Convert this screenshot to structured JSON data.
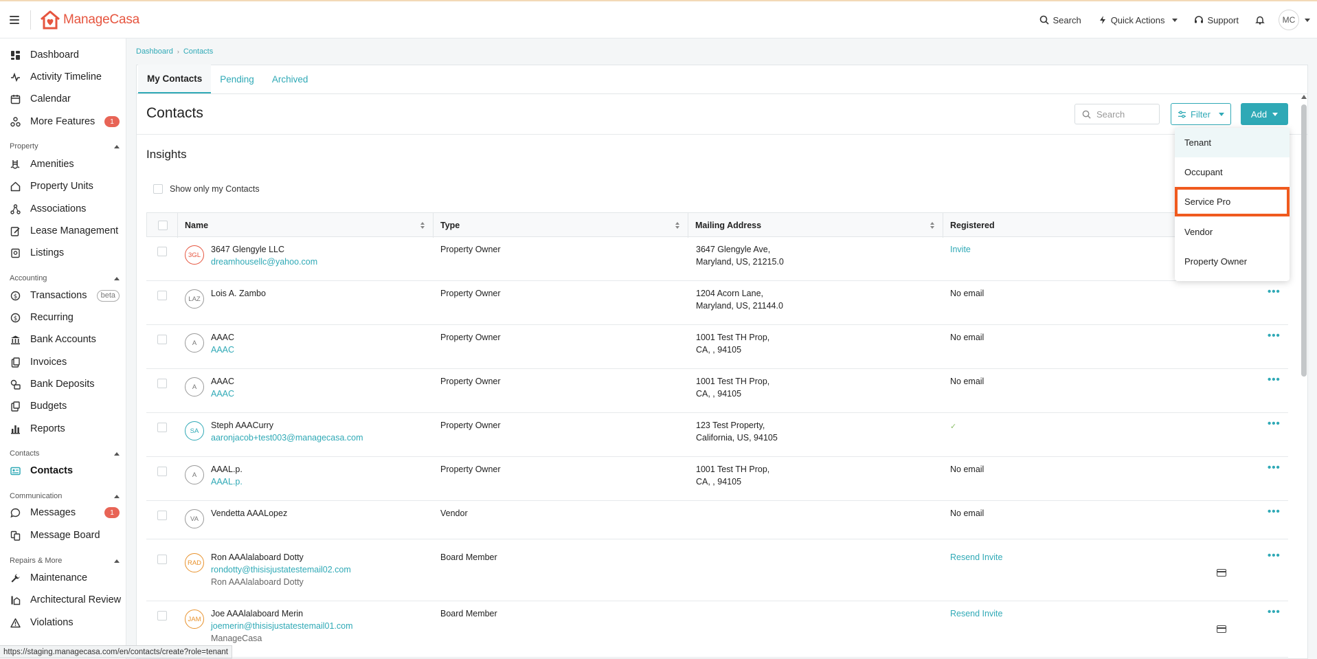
{
  "app": {
    "name_part1": "Manage",
    "name_part2": "Casa",
    "brand_color": "#e6553f",
    "accent_color": "#2fa9b6"
  },
  "topnav": {
    "search": "Search",
    "quick_actions": "Quick Actions",
    "support": "Support",
    "avatar": "MC"
  },
  "sidebar": {
    "items_top": [
      {
        "label": "Dashboard",
        "icon": "dashboard-icon"
      },
      {
        "label": "Activity Timeline",
        "icon": "activity-icon"
      },
      {
        "label": "Calendar",
        "icon": "calendar-icon"
      },
      {
        "label": "More Features",
        "icon": "features-icon",
        "badge": "1"
      }
    ],
    "property_section": "Property",
    "property_items": [
      "Amenities",
      "Property Units",
      "Associations",
      "Lease Management",
      "Listings"
    ],
    "accounting_section": "Accounting",
    "accounting_items": [
      "Transactions",
      "Recurring",
      "Bank Accounts",
      "Invoices",
      "Bank Deposits",
      "Budgets",
      "Reports"
    ],
    "beta_label": "beta",
    "contacts_section": "Contacts",
    "contacts_item": "Contacts",
    "communication_section": "Communication",
    "communication_items": [
      "Messages",
      "Message Board"
    ],
    "messages_badge": "1",
    "repairs_section": "Repairs & More",
    "repairs_items": [
      "Maintenance",
      "Architectural Review",
      "Violations"
    ]
  },
  "breadcrumb": {
    "items": [
      "Dashboard",
      "Contacts"
    ]
  },
  "tabs": [
    "My Contacts",
    "Pending",
    "Archived"
  ],
  "page": {
    "title": "Contacts",
    "search_placeholder": "Search",
    "filter_label": "Filter",
    "add_label": "Add",
    "insights": "Insights",
    "show_only": "Show only my Contacts"
  },
  "table": {
    "headers": [
      "Name",
      "Type",
      "Mailing Address",
      "Registered"
    ],
    "rows": [
      {
        "initials": "3GL",
        "name": "3647 Glengyle LLC",
        "sub": "dreamhousellc@yahoo.com",
        "sub2": "",
        "type": "Property Owner",
        "addr1": "3647 Glengyle Ave,",
        "addr2": "Maryland, US, 21215.0",
        "reg": "Invite"
      },
      {
        "initials": "LAZ",
        "name": "Lois A. Zambo",
        "sub": "",
        "sub2": "",
        "type": "Property Owner",
        "addr1": "1204 Acorn Lane,",
        "addr2": "Maryland, US, 21144.0",
        "reg": "No email"
      },
      {
        "initials": "A",
        "name": "AAAC",
        "sub": "AAAC",
        "sub2": "",
        "type": "Property Owner",
        "addr1": "1001 Test TH Prop,",
        "addr2": "CA, , 94105",
        "reg": "No email"
      },
      {
        "initials": "A",
        "name": "AAAC",
        "sub": "AAAC",
        "sub2": "",
        "type": "Property Owner",
        "addr1": "1001 Test TH Prop,",
        "addr2": "CA, , 94105",
        "reg": "No email"
      },
      {
        "initials": "SA",
        "name": "Steph AAACurry",
        "sub": "aaronjacob+test003@managecasa.com",
        "sub2": "",
        "type": "Property Owner",
        "addr1": "123 Test Property,",
        "addr2": "California, US, 94105",
        "reg": "✓"
      },
      {
        "initials": "A",
        "name": "AAAL.p.",
        "sub": "AAAL.p.",
        "sub2": "",
        "type": "Property Owner",
        "addr1": "1001 Test TH Prop,",
        "addr2": "CA, , 94105",
        "reg": "No email"
      },
      {
        "initials": "VA",
        "name": "Vendetta AAALopez",
        "sub": "",
        "sub2": "",
        "type": "Vendor",
        "addr1": "",
        "addr2": "",
        "reg": "No email"
      },
      {
        "initials": "RAD",
        "name": "Ron AAAlalaboard Dotty",
        "sub": "rondotty@thisisjustatestemail02.com",
        "sub2": "Ron AAAlalaboard Dotty",
        "type": "Board Member",
        "addr1": "",
        "addr2": "",
        "reg": "Resend Invite"
      },
      {
        "initials": "JAM",
        "name": "Joe AAAlalaboard Merin",
        "sub": "joemerin@thisisjustatestemail01.com",
        "sub2": "ManageCasa",
        "type": "Board Member",
        "addr1": "",
        "addr2": "",
        "reg": "Resend Invite"
      }
    ]
  },
  "add_dropdown": {
    "items": [
      "Tenant",
      "Occupant",
      "Service Pro",
      "Vendor",
      "Property Owner"
    ],
    "highlighted": "Service Pro"
  },
  "status_url": "https://staging.managecasa.com/en/contacts/create?role=tenant"
}
